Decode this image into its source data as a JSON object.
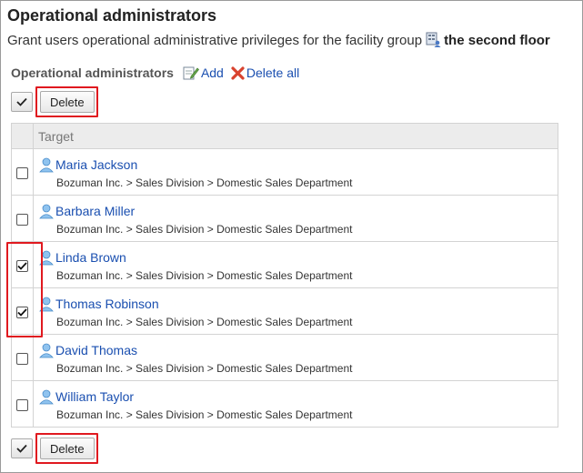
{
  "page": {
    "title": "Operational administrators",
    "description_prefix": "Grant users operational administrative privileges for the facility group",
    "facility_group_name": "the second floor"
  },
  "section": {
    "label": "Operational administrators",
    "add_label": "Add",
    "delete_all_label": "Delete all"
  },
  "toolbar": {
    "delete_label": "Delete"
  },
  "table": {
    "column_target": "Target",
    "rows": [
      {
        "name": "Maria Jackson",
        "path": "Bozuman Inc. > Sales Division > Domestic Sales Department",
        "checked": false
      },
      {
        "name": "Barbara Miller",
        "path": "Bozuman Inc. > Sales Division > Domestic Sales Department",
        "checked": false
      },
      {
        "name": "Linda Brown",
        "path": "Bozuman Inc. > Sales Division > Domestic Sales Department",
        "checked": true
      },
      {
        "name": "Thomas Robinson",
        "path": "Bozuman Inc. > Sales Division > Domestic Sales Department",
        "checked": true
      },
      {
        "name": "David Thomas",
        "path": "Bozuman Inc. > Sales Division > Domestic Sales Department",
        "checked": false
      },
      {
        "name": "William Taylor",
        "path": "Bozuman Inc. > Sales Division > Domestic Sales Department",
        "checked": false
      }
    ]
  },
  "colors": {
    "link": "#1a4fb0",
    "highlight": "#e0191f",
    "header_bg": "#ececec"
  }
}
